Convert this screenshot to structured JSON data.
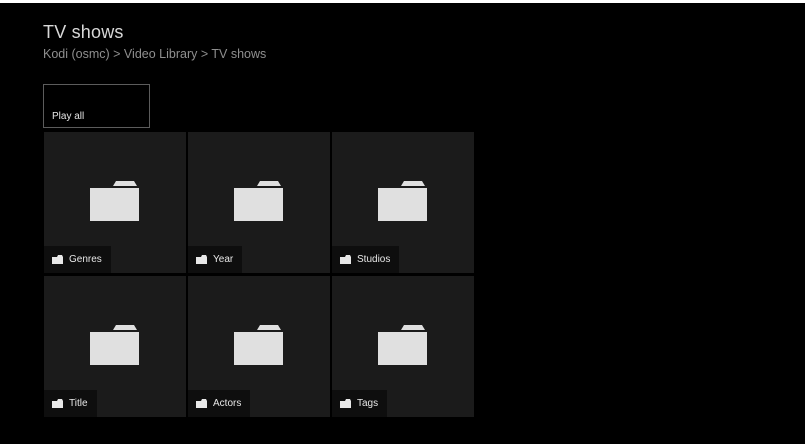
{
  "header": {
    "title": "TV shows",
    "breadcrumb": "Kodi (osmc) > Video Library > TV shows"
  },
  "play_all": {
    "label": "Play all"
  },
  "tiles": [
    {
      "label": "Genres",
      "icon": "folder-icon"
    },
    {
      "label": "Year",
      "icon": "folder-icon"
    },
    {
      "label": "Studios",
      "icon": "folder-icon"
    },
    {
      "label": "Title",
      "icon": "folder-icon"
    },
    {
      "label": "Actors",
      "icon": "folder-icon"
    },
    {
      "label": "Tags",
      "icon": "folder-icon"
    }
  ],
  "colors": {
    "background": "#000000",
    "tile": "#1b1b1b",
    "label_bar": "#0e0e0e",
    "folder_icon": "#e0e0e0",
    "title_text": "#d8d8d8",
    "breadcrumb_text": "#8f8f8f"
  }
}
